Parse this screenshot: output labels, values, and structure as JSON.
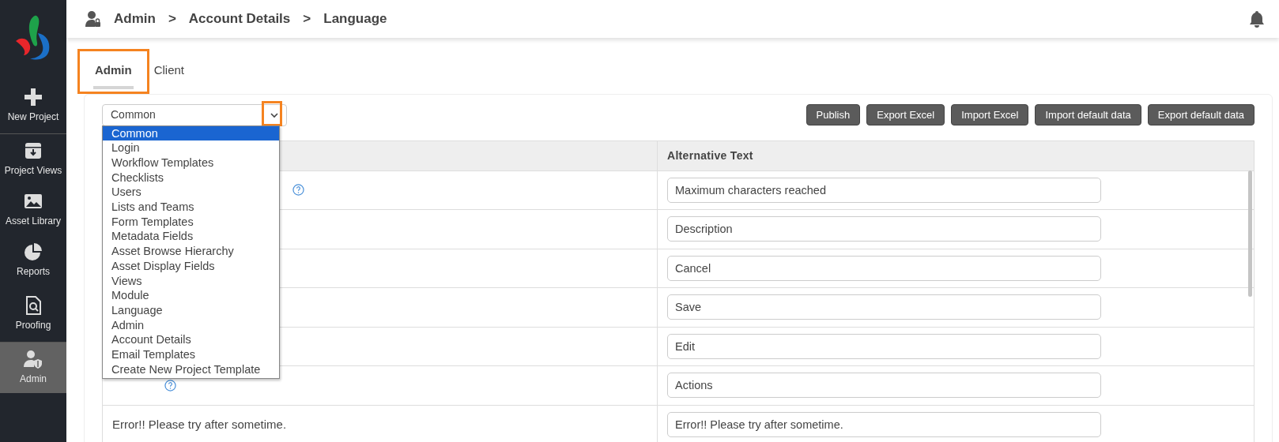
{
  "sidebar": {
    "items": [
      {
        "label": "New Project",
        "selected": false,
        "divider_after": true
      },
      {
        "label": "Project Views",
        "selected": false,
        "divider_after": false
      },
      {
        "label": "Asset Library",
        "selected": false,
        "divider_after": false
      },
      {
        "label": "Reports",
        "selected": false,
        "divider_after": false
      },
      {
        "label": "Proofing",
        "selected": false,
        "divider_after": true
      },
      {
        "label": "Admin",
        "selected": true,
        "divider_after": false
      }
    ]
  },
  "breadcrumb": [
    "Admin",
    "Account Details",
    "Language"
  ],
  "breadcrumb_separator": ">",
  "tabs": [
    {
      "label": "Admin",
      "selected": true,
      "highlighted": true
    },
    {
      "label": "Client",
      "selected": false,
      "highlighted": false
    }
  ],
  "module_select": {
    "value": "Common",
    "expanded": true,
    "caret_highlighted": true,
    "options": [
      {
        "label": "Common",
        "selected": true
      },
      {
        "label": "Login",
        "selected": false
      },
      {
        "label": "Workflow Templates",
        "selected": false
      },
      {
        "label": "Checklists",
        "selected": false
      },
      {
        "label": "Users",
        "selected": false
      },
      {
        "label": "Lists and Teams",
        "selected": false
      },
      {
        "label": "Form Templates",
        "selected": false
      },
      {
        "label": "Metadata Fields",
        "selected": false
      },
      {
        "label": "Asset Browse Hierarchy",
        "selected": false
      },
      {
        "label": "Asset Display Fields",
        "selected": false
      },
      {
        "label": "Views",
        "selected": false
      },
      {
        "label": "Module",
        "selected": false
      },
      {
        "label": "Language",
        "selected": false
      },
      {
        "label": "Admin",
        "selected": false
      },
      {
        "label": "Account Details",
        "selected": false
      },
      {
        "label": "Email Templates",
        "selected": false
      },
      {
        "label": "Create New Project Template",
        "selected": false
      }
    ]
  },
  "buttons": [
    "Publish",
    "Export Excel",
    "Import Excel",
    "Import default data",
    "Export default data"
  ],
  "table": {
    "columns": [
      "Alternative Text"
    ],
    "rows": [
      {
        "help": true,
        "alternative_text": "Maximum characters reached"
      },
      {
        "help": false,
        "alternative_text": "Description"
      },
      {
        "help": false,
        "alternative_text": "Cancel"
      },
      {
        "help": false,
        "alternative_text": "Save"
      },
      {
        "help": false,
        "alternative_text": "Edit"
      },
      {
        "help": true,
        "alternative_text": "Actions"
      },
      {
        "help": false,
        "text": "Error!! Please try after sometime.",
        "alternative_text": "Error!! Please try after sometime."
      }
    ]
  }
}
